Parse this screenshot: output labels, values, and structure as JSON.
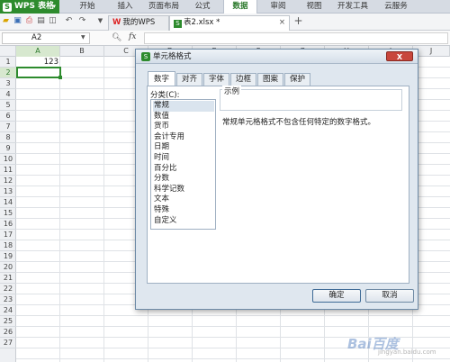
{
  "ribbon": {
    "app_name": "WPS 表格",
    "app_logo": "S",
    "app_arrow": "▾",
    "tabs": [
      "开始",
      "插入",
      "页面布局",
      "公式",
      "数据",
      "审阅",
      "视图",
      "开发工具",
      "云服务"
    ],
    "active_tab": "数据",
    "accent_color": "#2d8b2d"
  },
  "doc_tabs": {
    "tab1_label": "我的WPS",
    "tab1_logo": "W",
    "tab2_label": "表2.xlsx *",
    "tab2_logo": "S",
    "close_glyph": "×",
    "add_glyph": "+"
  },
  "quick_access_icons": [
    "open-icon",
    "save-icon",
    "print-icon",
    "print-preview-icon",
    "export-icon",
    "undo-icon",
    "redo-icon",
    "customize-icon"
  ],
  "formula_bar": {
    "name_box": "A2",
    "fx_label": "fx",
    "formula": ""
  },
  "grid": {
    "columns": [
      "A",
      "B",
      "C",
      "D",
      "E",
      "F",
      "G",
      "H",
      "I",
      "J"
    ],
    "rows": [
      "1",
      "2",
      "3",
      "4",
      "5",
      "6",
      "7",
      "8",
      "9",
      "10",
      "11",
      "12",
      "13",
      "14",
      "15",
      "16",
      "17",
      "18",
      "19",
      "20",
      "21",
      "22",
      "23",
      "24",
      "25",
      "26",
      "27"
    ],
    "cell_a1": "123",
    "selected_cell": "A2"
  },
  "dialog": {
    "title": "单元格格式",
    "title_logo": "S",
    "close_label": "X",
    "tabs": [
      "数字",
      "对齐",
      "字体",
      "边框",
      "图案",
      "保护"
    ],
    "active_tab": "数字",
    "category_label": "分类(C):",
    "categories": [
      "常规",
      "数值",
      "货币",
      "会计专用",
      "日期",
      "时间",
      "百分比",
      "分数",
      "科学记数",
      "文本",
      "特殊",
      "自定义"
    ],
    "selected_category": "常规",
    "sample_label": "示例",
    "description": "常规单元格格式不包含任何特定的数字格式。",
    "ok_label": "确定",
    "cancel_label": "取消"
  },
  "watermark": {
    "logo": "Bai百度",
    "sub": "jingyan.baidu.com"
  }
}
